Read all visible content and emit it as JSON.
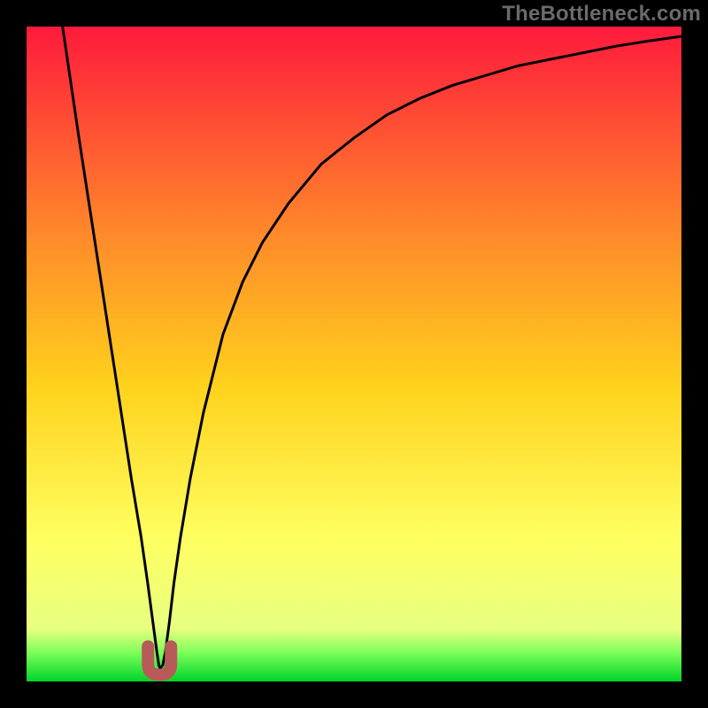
{
  "watermark": "TheBottleneck.com",
  "chart_data": {
    "type": "line",
    "title": "",
    "xlabel": "",
    "ylabel": "",
    "xlim": [
      0,
      100
    ],
    "ylim": [
      0,
      100
    ],
    "grid": false,
    "legend": false,
    "annotations": [],
    "series": [
      {
        "name": "curve",
        "x": [
          5.5,
          8,
          10,
          12,
          14,
          16,
          17.5,
          18.5,
          19.3,
          19.9,
          20.2,
          20.4,
          20.8,
          21.2,
          21.8,
          22.5,
          23.5,
          25,
          27,
          30,
          33,
          36,
          40,
          45,
          50,
          55,
          60,
          65,
          70,
          75,
          80,
          85,
          90,
          95,
          100
        ],
        "y": [
          100,
          83,
          70,
          57,
          44,
          31,
          22,
          15,
          9,
          4.5,
          2.5,
          2,
          2.5,
          4.5,
          9,
          15,
          22,
          31,
          41,
          53,
          61,
          67,
          73,
          79,
          83,
          86.5,
          89,
          91,
          92.5,
          94,
          95,
          96,
          97,
          97.8,
          98.5
        ]
      }
    ],
    "marker": {
      "name": "optimal-point",
      "x": 20.3,
      "y": 2.1,
      "shape": "u-shape",
      "color": "#b85a5a"
    },
    "background_gradient": {
      "top": "#ff1a3c",
      "mid_upper": "#ff8a2a",
      "mid": "#ffd21c",
      "mid_lower": "#ffff60",
      "green_band": "#7fff5a",
      "bottom": "#00d42a"
    }
  }
}
